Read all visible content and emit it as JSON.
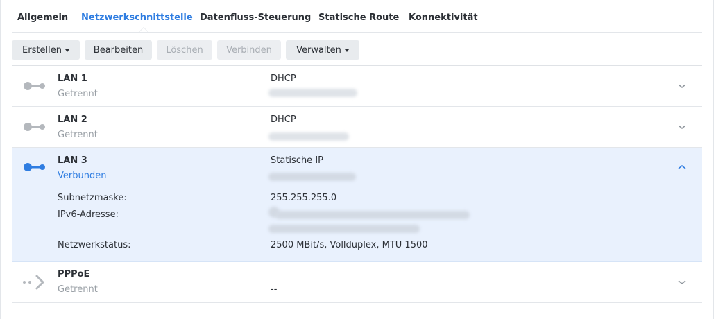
{
  "tabs": [
    {
      "label": "Allgemein",
      "active": false
    },
    {
      "label": "Netzwerkschnittstelle",
      "active": true
    },
    {
      "label": "Datenfluss-Steuerung",
      "active": false
    },
    {
      "label": "Statische Route",
      "active": false
    },
    {
      "label": "Konnektivität",
      "active": false
    }
  ],
  "toolbar": {
    "create": "Erstellen",
    "edit": "Bearbeiten",
    "delete": "Löschen",
    "connect": "Verbinden",
    "manage": "Verwalten"
  },
  "interfaces": [
    {
      "name": "LAN 1",
      "status": "Getrennt",
      "mode": "DHCP",
      "connected": false
    },
    {
      "name": "LAN 2",
      "status": "Getrennt",
      "mode": "DHCP",
      "connected": false
    },
    {
      "name": "LAN 3",
      "status": "Verbunden",
      "mode": "Statische IP",
      "connected": true,
      "details": {
        "subnet_label": "Subnetzmaske:",
        "subnet_value": "255.255.255.0",
        "ipv6_label": "IPv6-Adresse:",
        "netstatus_label": "Netzwerkstatus:",
        "netstatus_value": "2500 MBit/s, Vollduplex, MTU 1500"
      }
    },
    {
      "name": "PPPoE",
      "status": "Getrennt",
      "mode": "--",
      "connected": false
    }
  ],
  "colors": {
    "accent": "#2f7de1",
    "disconnected": "#b4b8bd",
    "expanded_bg": "#e9f1fd"
  },
  "icons": {
    "ethernet": "ethernet-plug-icon",
    "pppoe": "pppoe-dots-arrow-icon",
    "expand": "chevron-down-icon",
    "collapse": "chevron-up-icon"
  }
}
